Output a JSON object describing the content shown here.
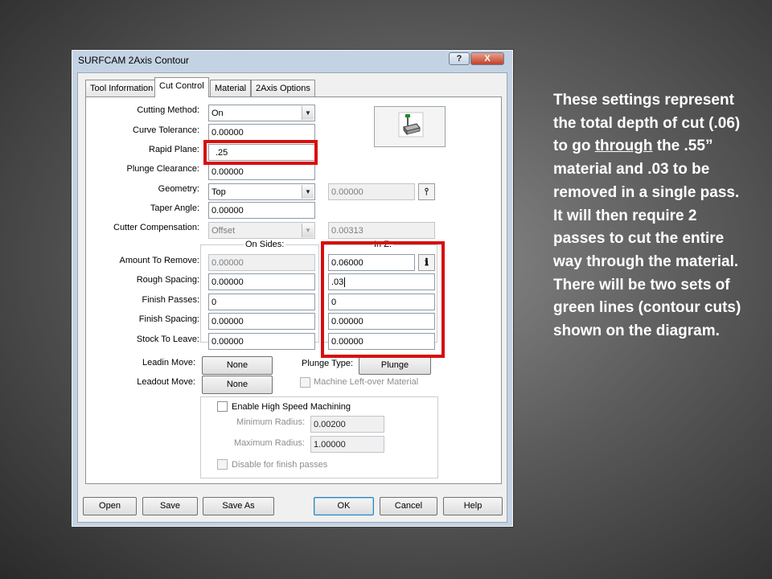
{
  "window": {
    "title": "SURFCAM 2Axis Contour",
    "help_btn": "?",
    "close_btn": "X"
  },
  "tabs": [
    "Tool Information",
    "Cut Control",
    "Material",
    "2Axis Options"
  ],
  "form": {
    "cutting_method": {
      "label": "Cutting Method:",
      "value": "On"
    },
    "curve_tolerance": {
      "label": "Curve Tolerance:",
      "value": "0.00000"
    },
    "rapid_plane": {
      "label": "Rapid Plane:",
      "value": ".25"
    },
    "plunge_clearance": {
      "label": "Plunge Clearance:",
      "value": "0.00000"
    },
    "geometry": {
      "label": "Geometry:",
      "value": "Top",
      "aux_value": "0.00000"
    },
    "taper_angle": {
      "label": "Taper Angle:",
      "value": "0.00000"
    },
    "cutter_compensation": {
      "label": "Cutter Compensation:",
      "value": "Offset",
      "aux_value": "0.00313"
    }
  },
  "groups": {
    "on_sides": "On Sides:",
    "in_z": "In Z:"
  },
  "rows": [
    {
      "label": "Amount To Remove:",
      "sides": "0.00000",
      "z": "0.06000"
    },
    {
      "label": "Rough Spacing:",
      "sides": "0.00000",
      "z": ".03"
    },
    {
      "label": "Finish Passes:",
      "sides": "0",
      "z": "0"
    },
    {
      "label": "Finish Spacing:",
      "sides": "0.00000",
      "z": "0.00000"
    },
    {
      "label": "Stock To Leave:",
      "sides": "0.00000",
      "z": "0.00000"
    }
  ],
  "leadin": {
    "label": "Leadin Move:",
    "button": "None"
  },
  "leadout": {
    "label": "Leadout Move:",
    "button": "None"
  },
  "plunge": {
    "label": "Plunge Type:",
    "button": "Plunge"
  },
  "machine_leftover": "Machine Left-over Material",
  "hsm": {
    "enable_label": "Enable High Speed Machining",
    "min_radius_label": "Minimum Radius:",
    "min_radius": "0.00200",
    "max_radius_label": "Maximum Radius:",
    "max_radius": "1.00000",
    "disable_finish": "Disable for finish passes"
  },
  "buttons": {
    "open": "Open",
    "save": "Save",
    "save_as": "Save As",
    "ok": "OK",
    "cancel": "Cancel",
    "help": "Help"
  },
  "side_text": {
    "p1": "These settings represent the total depth of cut (.06) to go ",
    "p2": "through",
    "p3": " the .55” material and .03 to be removed in a single pass. It will then require 2 passes to cut the entire way through the material. There will be two sets of green lines (contour cuts) shown on the diagram."
  },
  "colors": {
    "highlight": "#d70f0f",
    "window_frame": "#c4d3e4"
  }
}
